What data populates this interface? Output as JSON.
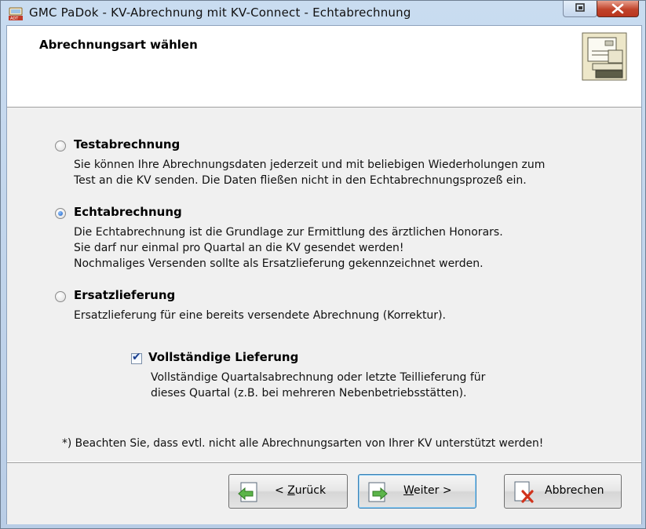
{
  "window": {
    "title": "GMC PaDok  -  KV-Abrechnung mit KV-Connect  -  Echtabrechnung"
  },
  "header": {
    "title": "Abrechnungsart wählen"
  },
  "options": [
    {
      "label": "Testabrechnung",
      "selected": false,
      "lines": [
        "Sie können Ihre Abrechnungsdaten jederzeit und mit beliebigen Wiederholungen zum",
        "Test an die KV senden. Die Daten fließen nicht in den Echtabrechnungsprozeß ein."
      ]
    },
    {
      "label": "Echtabrechnung",
      "selected": true,
      "lines": [
        "Die Echtabrechnung ist die Grundlage zur Ermittlung des ärztlichen Honorars.",
        "Sie darf nur einmal pro Quartal an die KV gesendet werden!",
        "Nochmaliges Versenden sollte als Ersatzlieferung gekennzeichnet werden."
      ]
    },
    {
      "label": "Ersatzlieferung",
      "selected": false,
      "lines": [
        "Ersatzlieferung für eine bereits versendete Abrechnung (Korrektur)."
      ]
    }
  ],
  "complete_delivery": {
    "label": "Vollständige Lieferung",
    "checked": true,
    "lines": [
      "Vollständige Quartalsabrechnung oder letzte Teillieferung für",
      "dieses Quartal (z.B. bei mehreren Nebenbetriebsstätten)."
    ]
  },
  "note": "*) Beachten Sie, dass evtl. nicht alle Abrechnungsarten von Ihrer KV unterstützt werden!",
  "buttons": {
    "back": {
      "prefix": "< ",
      "accel": "Z",
      "rest": "urück"
    },
    "next": {
      "accel": "W",
      "rest": "eiter >"
    },
    "cancel": {
      "label": "Abbrechen"
    }
  },
  "colors": {
    "accent": "#3c7fb1",
    "close": "#c0432a"
  },
  "icons": {
    "app": "adt-app-icon",
    "header": "document-stack-icon",
    "back": "back-arrow-icon",
    "next": "next-arrow-icon",
    "cancel": "cancel-x-icon"
  }
}
